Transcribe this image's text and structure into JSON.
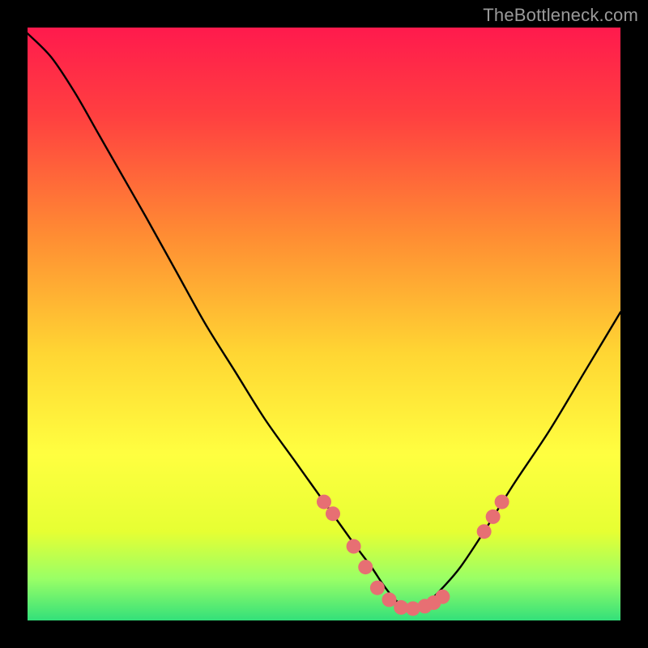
{
  "attribution": "TheBottleneck.com",
  "chart_data": {
    "type": "line",
    "title": "",
    "xlabel": "",
    "ylabel": "",
    "xlim": [
      0,
      100
    ],
    "ylim": [
      0,
      100
    ],
    "grid": false,
    "curve_description": "V-shaped bottleneck curve with minimum around x≈64; background is a red→yellow→green vertical gradient where lower values (near bottom) indicate better balance.",
    "gradient_stops": [
      {
        "offset": 0.0,
        "color": "#ff1a4d"
      },
      {
        "offset": 0.15,
        "color": "#ff4040"
      },
      {
        "offset": 0.35,
        "color": "#ff8c33"
      },
      {
        "offset": 0.55,
        "color": "#ffd633"
      },
      {
        "offset": 0.72,
        "color": "#ffff40"
      },
      {
        "offset": 0.85,
        "color": "#e6ff33"
      },
      {
        "offset": 0.93,
        "color": "#99ff66"
      },
      {
        "offset": 1.0,
        "color": "#33e07a"
      }
    ],
    "series": [
      {
        "name": "bottleneck-curve",
        "x": [
          0,
          4,
          8,
          12,
          16,
          20,
          25,
          30,
          35,
          40,
          45,
          50,
          55,
          58,
          60,
          62,
          64,
          66,
          68,
          70,
          73,
          77,
          82,
          88,
          94,
          100
        ],
        "y": [
          99,
          95,
          89,
          82,
          75,
          68,
          59,
          50,
          42,
          34,
          27,
          20,
          13,
          9,
          6,
          3.5,
          2.0,
          2.2,
          3.5,
          5.5,
          9,
          15,
          23,
          32,
          42,
          52
        ]
      }
    ],
    "markers": {
      "name": "highlighted-points",
      "color": "#e76f73",
      "radius": 9,
      "points": [
        {
          "x": 50,
          "y": 20
        },
        {
          "x": 51.5,
          "y": 18
        },
        {
          "x": 55,
          "y": 12.5
        },
        {
          "x": 57,
          "y": 9
        },
        {
          "x": 59,
          "y": 5.5
        },
        {
          "x": 61,
          "y": 3.5
        },
        {
          "x": 63,
          "y": 2.2
        },
        {
          "x": 65,
          "y": 2.0
        },
        {
          "x": 67,
          "y": 2.4
        },
        {
          "x": 68.5,
          "y": 3.0
        },
        {
          "x": 70,
          "y": 4.0
        },
        {
          "x": 77,
          "y": 15
        },
        {
          "x": 78.5,
          "y": 17.5
        },
        {
          "x": 80,
          "y": 20
        }
      ]
    }
  }
}
